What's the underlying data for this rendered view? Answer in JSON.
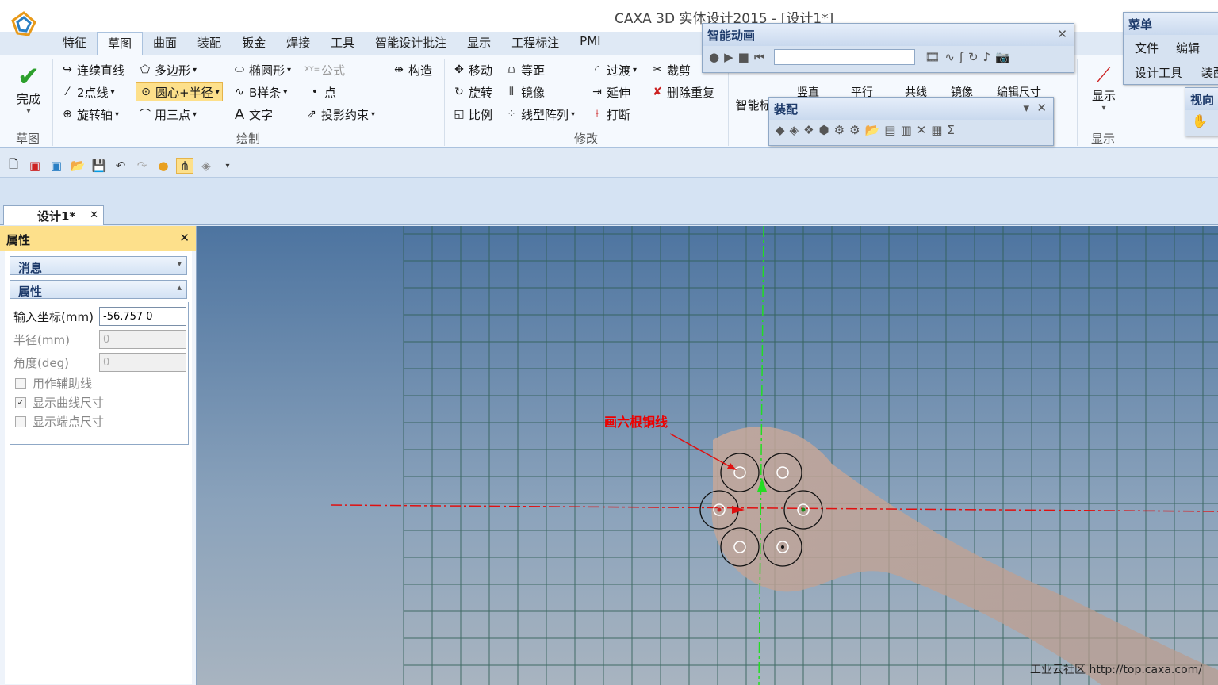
{
  "app": {
    "title": "CAXA 3D 实体设计2015 - [设计1*]"
  },
  "tabs": [
    "特征",
    "草图",
    "曲面",
    "装配",
    "钣金",
    "焊接",
    "工具",
    "智能设计批注",
    "显示",
    "工程标注",
    "PMI"
  ],
  "active_tab": "草图",
  "ribbon": {
    "finish": "完成",
    "group_sketch": "草图",
    "group_draw": "绘制",
    "group_modify": "修改",
    "group_display": "显示",
    "display_btn": "显示",
    "draw": {
      "polyline": "连续直线",
      "polygon": "多边形",
      "ellipse": "椭圆形",
      "formula": "公式",
      "construct": "构造",
      "line2p": "2点线",
      "circle_cr": "圆心+半径",
      "bspline": "B样条",
      "point": "点",
      "rotaxis": "旋转轴",
      "arc3p": "用三点",
      "text": "文字",
      "projconstraint": "投影约束"
    },
    "modify": {
      "move": "移动",
      "offset": "等距",
      "fillet": "过渡",
      "trim": "裁剪",
      "rotate": "旋转",
      "mirror": "镜像",
      "extend": "延伸",
      "deldup": "删除重复",
      "scale": "比例",
      "linear_array": "线型阵列",
      "break": "打断"
    },
    "smart": "智能标",
    "constraint_row": {
      "vertical": "竖直",
      "parallel": "平行",
      "collinear": "共线",
      "mirror": "镜像",
      "edit_dim": "编辑尺寸"
    }
  },
  "doc_tab": "设计1*",
  "panel": {
    "title": "属性",
    "section_msg": "消息",
    "section_prop": "属性",
    "coord_label": "输入坐标(mm)",
    "coord_value": "-56.757 0",
    "radius_label": "半径(mm)",
    "radius_value": "0",
    "angle_label": "角度(deg)",
    "angle_value": "0",
    "chk_aux": "用作辅助线",
    "chk_curve_dim": "显示曲线尺寸",
    "chk_end_dim": "显示端点尺寸"
  },
  "anim_toolbar": {
    "title": "智能动画"
  },
  "assembly_toolbar": {
    "title": "装配"
  },
  "menu_panel": {
    "title": "菜单",
    "file": "文件",
    "edit": "编辑",
    "design_tools": "设计工具",
    "assem": "装配"
  },
  "view_panel": {
    "title": "视向"
  },
  "annotation": "画六根铜线",
  "watermark": "工业云社区 http://top.caxa.com/"
}
